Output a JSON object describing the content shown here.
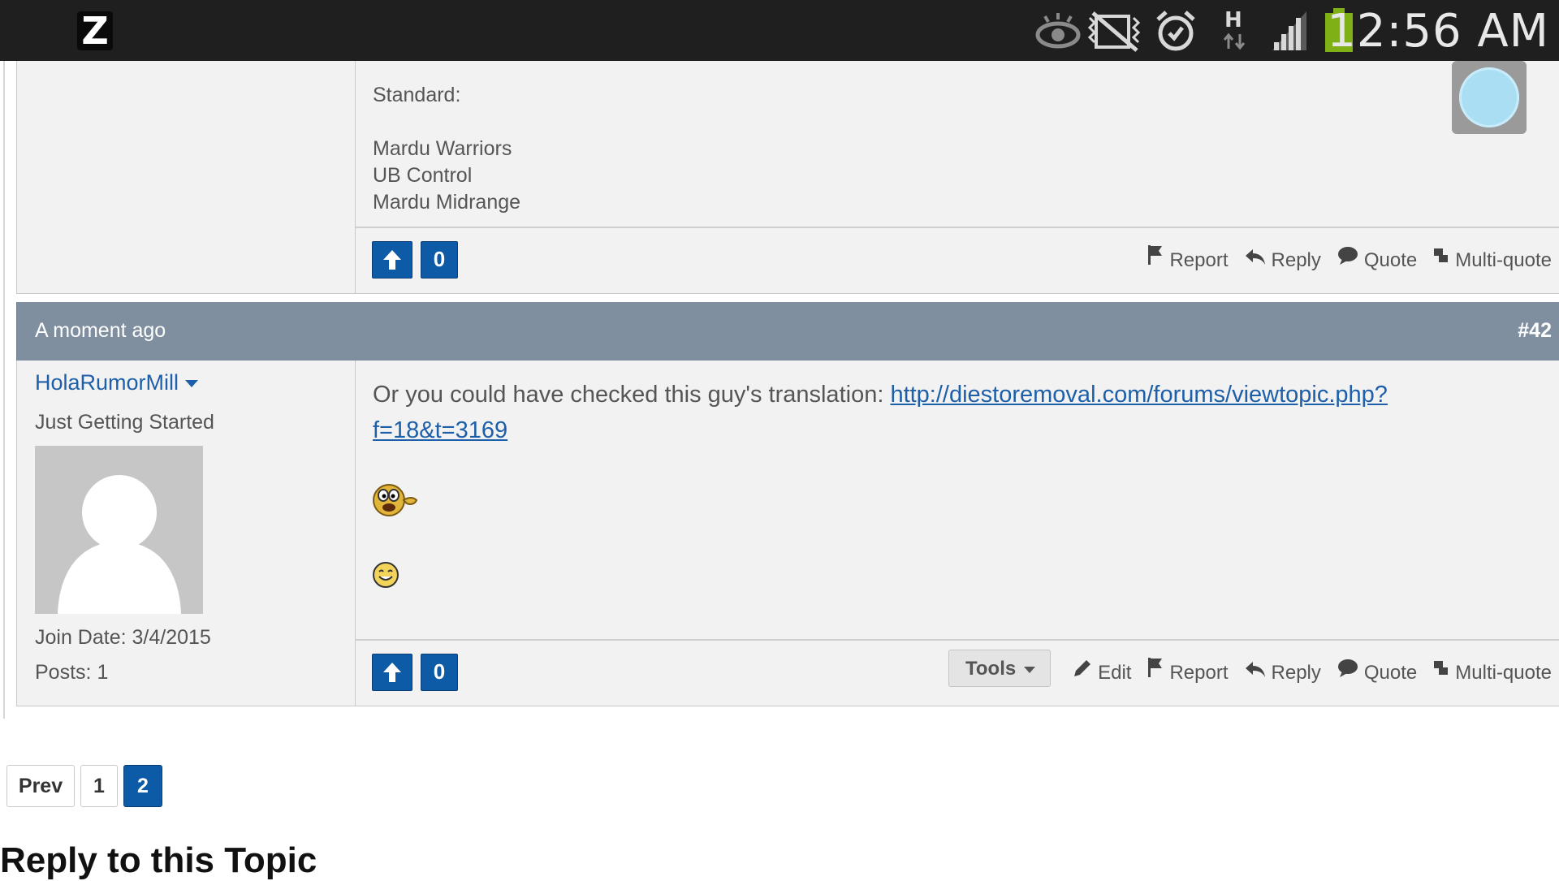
{
  "status_bar": {
    "time": "12:56 AM",
    "network": "H",
    "icons": [
      "app-z-icon",
      "eye-icon",
      "mute-icon",
      "alarm-icon",
      "data-arrows-icon",
      "signal-icon",
      "battery-icon"
    ],
    "app_letter": "Z"
  },
  "post_41": {
    "body_lines": [
      "Standard:",
      "",
      "Mardu Warriors",
      "UB Control",
      "Mardu Midrange"
    ],
    "vote_count": "0",
    "actions": [
      "Report",
      "Reply",
      "Quote",
      "Multi-quote"
    ]
  },
  "post_42": {
    "time": "A moment ago",
    "number": "#42",
    "username": "HolaRumorMill",
    "rank": "Just Getting Started",
    "join_date_label": "Join Date:",
    "join_date": "3/4/2015",
    "posts_label": "Posts:",
    "posts": "1",
    "message_text": "Or you could have checked this guy's translation: ",
    "link_line1": "http://diestoremoval.com/forums/viewtopic.php?",
    "link_line2": "f=18&t=3169",
    "vote_count": "0",
    "tools_label": "Tools",
    "actions": [
      "Edit",
      "Report",
      "Reply",
      "Quote",
      "Multi-quote"
    ]
  },
  "pagination": {
    "prev": "Prev",
    "pages": [
      "1",
      "2"
    ],
    "current": "2"
  },
  "reply_heading": "Reply to this Topic",
  "colors": {
    "accent": "#0d5aa7",
    "header_bar": "#7f8fa0",
    "link": "#1d5fa8",
    "status_bar": "#1f1f1f",
    "battery": "#7fb015"
  }
}
